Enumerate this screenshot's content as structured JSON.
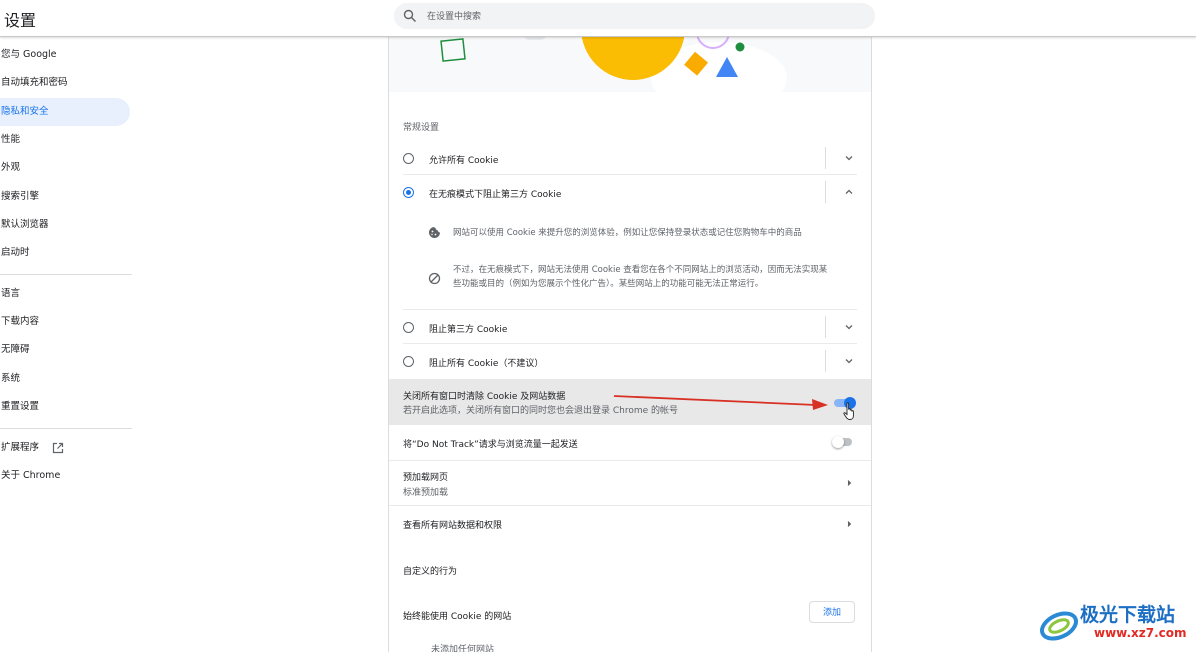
{
  "header": {
    "title": "设置",
    "search_placeholder": "在设置中搜索"
  },
  "sidebar": {
    "items": [
      {
        "label": "您与 Google"
      },
      {
        "label": "自动填充和密码"
      },
      {
        "label": "隐私和安全",
        "active": true
      },
      {
        "label": "性能"
      },
      {
        "label": "外观"
      },
      {
        "label": "搜索引擎"
      },
      {
        "label": "默认浏览器"
      },
      {
        "label": "启动时"
      },
      {
        "label": "语言"
      },
      {
        "label": "下载内容"
      },
      {
        "label": "无障碍"
      },
      {
        "label": "系统"
      },
      {
        "label": "重置设置"
      },
      {
        "label": "扩展程序"
      },
      {
        "label": "关于 Chrome"
      }
    ]
  },
  "main": {
    "general_settings_label": "常规设置",
    "cookie_options": [
      {
        "label": "允许所有 Cookie",
        "selected": false
      },
      {
        "label": "在无痕模式下阻止第三方 Cookie",
        "selected": true
      },
      {
        "label": "阻止第三方 Cookie",
        "selected": false
      },
      {
        "label": "阻止所有 Cookie（不建议）",
        "selected": false
      }
    ],
    "expanded_desc_1": "网站可以使用 Cookie 来提升您的浏览体验，例如让您保持登录状态或记住您购物车中的商品",
    "expanded_desc_2_line1": "不过，在无痕模式下，网站无法使用 Cookie 查看您在各个不同网站上的浏览活动，因而无法实现某",
    "expanded_desc_2_line2": "些功能或目的（例如为您展示个性化广告）。某些网站上的功能可能无法正常运行。",
    "clear_on_exit": {
      "title": "关闭所有窗口时清除 Cookie 及网站数据",
      "subtitle": "若开启此选项，关闭所有窗口的同时您也会退出登录 Chrome 的帐号",
      "enabled": true
    },
    "do_not_track": {
      "title": "将“Do Not Track”请求与浏览流量一起发送",
      "enabled": false
    },
    "preload": {
      "title": "预加载网页",
      "subtitle": "标准预加载"
    },
    "site_data_link": "查看所有网站数据和权限",
    "custom_behavior_label": "自定义的行为",
    "always_allow_label": "始终能使用 Cookie 的网站",
    "add_button": "添加",
    "no_sites_added": "未添加任何网站"
  },
  "watermark": {
    "title": "极光下载站",
    "url": "www.xz7.com"
  },
  "colors": {
    "accent": "#1a73e8",
    "annotation_arrow": "#d93025"
  }
}
